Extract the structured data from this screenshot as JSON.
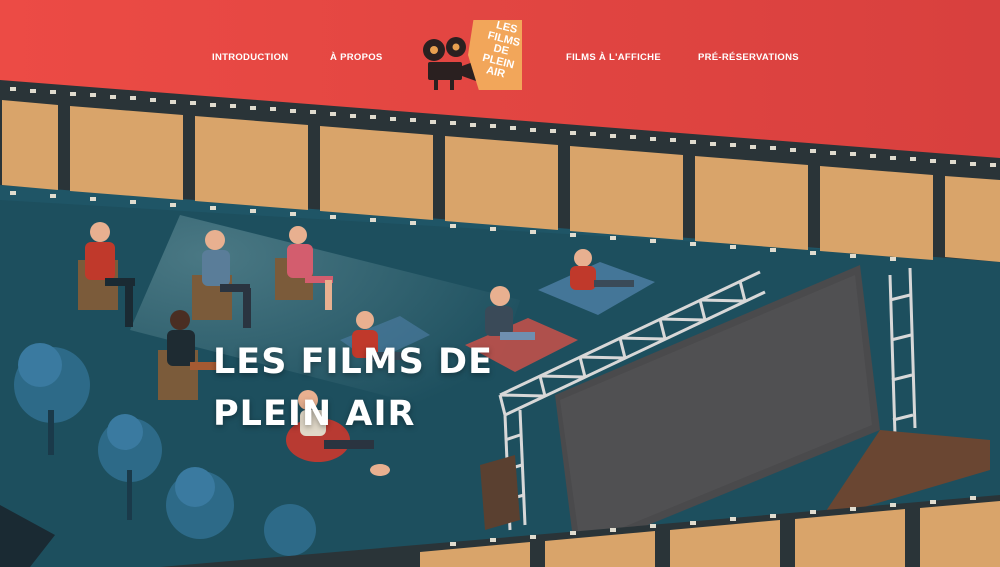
{
  "nav": {
    "left": [
      "INTRODUCTION",
      "À PROPOS"
    ],
    "right": [
      "FILMS À L'AFFICHE",
      "PRÉ-RÉSERVATIONS"
    ]
  },
  "logo": {
    "lines": [
      "LES",
      "FILMS",
      "DE",
      "PLEIN",
      "AIR"
    ],
    "icon": "film-projector-icon"
  },
  "hero": {
    "title_lines": [
      "LES FILMS DE",
      "PLEIN AIR"
    ]
  },
  "colors": {
    "header_red": "#e8483f",
    "film_strip": "#2a3438",
    "film_frame": "#d9a46a",
    "scene_teal": "#1f5566",
    "logo_orange": "#f2a65a",
    "text": "#ffffff"
  }
}
